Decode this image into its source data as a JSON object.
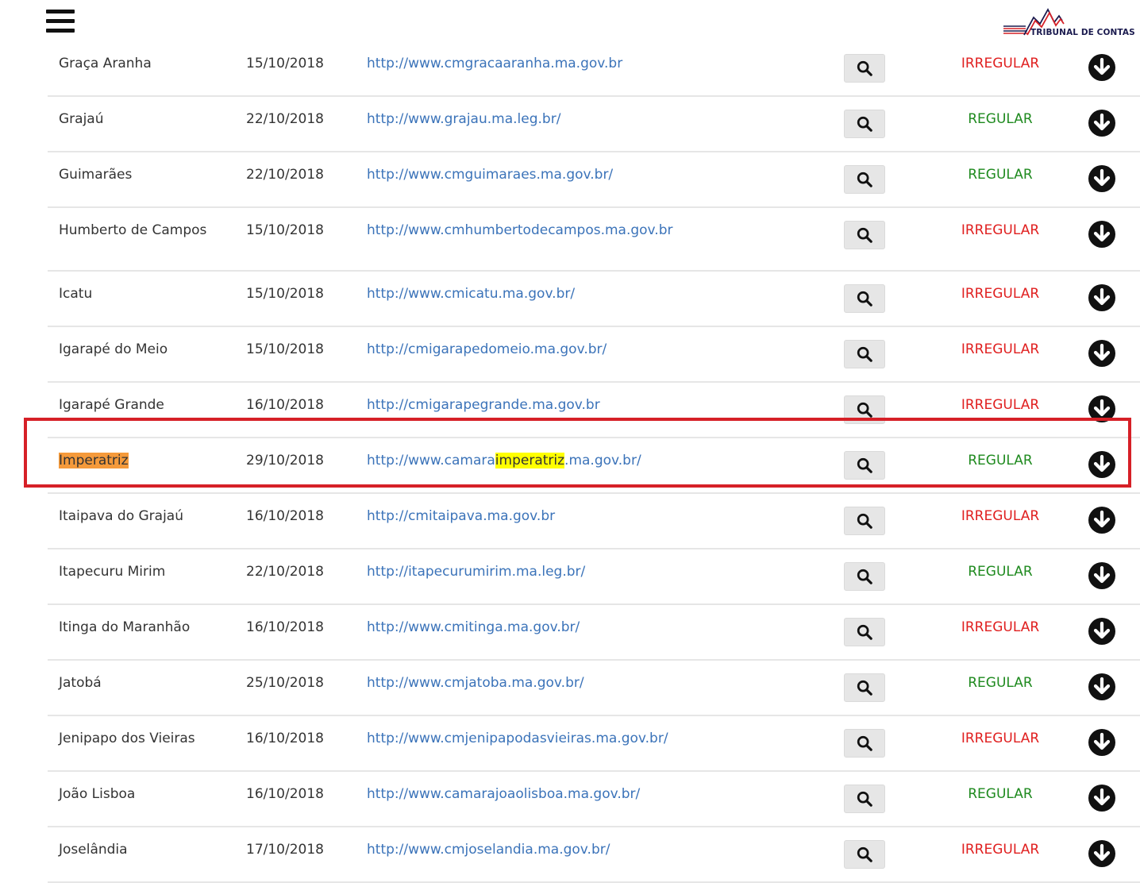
{
  "header": {
    "menu_icon": "hamburger-menu-icon",
    "logo_text": "TRIBUNAL DE CONTAS",
    "logo_icon": "chart-line-logo-icon"
  },
  "colors": {
    "link": "#3b73b9",
    "irregular": "#e02020",
    "regular": "#1f8a1f",
    "highlight_box": "#d62027",
    "highlight_orange": "#f59a3b",
    "highlight_yellow": "#ffff00"
  },
  "rows": [
    {
      "name": "Graça Aranha",
      "date": "15/10/2018",
      "url": "http://www.cmgracaaranha.ma.gov.br",
      "status": "IRREGULAR"
    },
    {
      "name": "Grajaú",
      "date": "22/10/2018",
      "url": "http://www.grajau.ma.leg.br/",
      "status": "REGULAR"
    },
    {
      "name": "Guimarães",
      "date": "22/10/2018",
      "url": "http://www.cmguimaraes.ma.gov.br/",
      "status": "REGULAR"
    },
    {
      "name": "Humberto de Campos",
      "date": "15/10/2018",
      "url": "http://www.cmhumbertodecampos.ma.gov.br",
      "status": "IRREGULAR"
    },
    {
      "name": "Icatu",
      "date": "15/10/2018",
      "url": "http://www.cmicatu.ma.gov.br/",
      "status": "IRREGULAR"
    },
    {
      "name": "Igarapé do Meio",
      "date": "15/10/2018",
      "url": "http://cmigarapedomeio.ma.gov.br/",
      "status": "IRREGULAR"
    },
    {
      "name": "Igarapé Grande",
      "date": "16/10/2018",
      "url": "http://cmigarapegrande.ma.gov.br",
      "status": "IRREGULAR"
    },
    {
      "name": "Imperatriz",
      "date": "29/10/2018",
      "url_prefix": "http://www.camara",
      "url_match": "imperatriz",
      "url_suffix": ".ma.gov.br/",
      "status": "REGULAR"
    },
    {
      "name": "Itaipava do Grajaú",
      "date": "16/10/2018",
      "url": "http://cmitaipava.ma.gov.br",
      "status": "IRREGULAR"
    },
    {
      "name": "Itapecuru Mirim",
      "date": "22/10/2018",
      "url": "http://itapecurumirim.ma.leg.br/",
      "status": "REGULAR"
    },
    {
      "name": "Itinga do Maranhão",
      "date": "16/10/2018",
      "url": "http://www.cmitinga.ma.gov.br/",
      "status": "IRREGULAR"
    },
    {
      "name": "Jatobá",
      "date": "25/10/2018",
      "url": "http://www.cmjatoba.ma.gov.br/",
      "status": "REGULAR"
    },
    {
      "name": "Jenipapo dos Vieiras",
      "date": "16/10/2018",
      "url": "http://www.cmjenipapodasvieiras.ma.gov.br/",
      "status": "IRREGULAR"
    },
    {
      "name": "João Lisboa",
      "date": "16/10/2018",
      "url": "http://www.camarajoaolisboa.ma.gov.br/",
      "status": "REGULAR"
    },
    {
      "name": "Joselândia",
      "date": "17/10/2018",
      "url": "http://www.cmjoselandia.ma.gov.br/",
      "status": "IRREGULAR"
    }
  ]
}
